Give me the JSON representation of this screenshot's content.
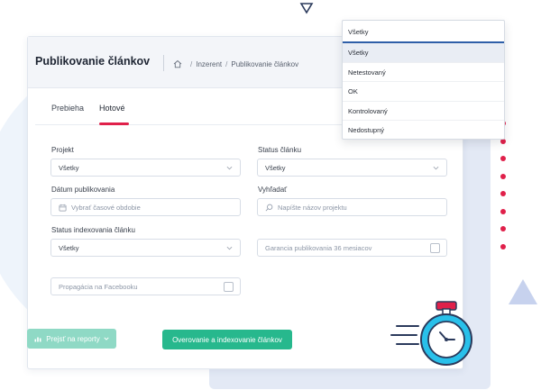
{
  "header": {
    "title": "Publikovanie článkov",
    "breadcrumb": {
      "home_icon": "home-icon",
      "items": [
        "Inzerent",
        "Publikovanie článkov"
      ]
    }
  },
  "tabs": [
    {
      "label": "Prebieha",
      "active": false
    },
    {
      "label": "Hotové",
      "active": true
    }
  ],
  "filters": {
    "projekt": {
      "label": "Projekt",
      "value": "Všetky"
    },
    "status_clanku": {
      "label": "Status článku",
      "value": "Všetky"
    },
    "datum": {
      "label": "Dátum publikovania",
      "placeholder": "Vybrať časové obdobie"
    },
    "vyhladat": {
      "label": "Vyhľadať",
      "placeholder": "Napíšte názov projektu"
    },
    "status_indexovania": {
      "label": "Status indexovania článku",
      "value": "Všetky"
    },
    "garancia": {
      "label": "Garancia publikovania 36 mesiacov",
      "checked": false
    },
    "propagacia": {
      "label": "Propagácia na Facebooku",
      "checked": false
    }
  },
  "buttons": {
    "report": "Prejsť na reporty",
    "verify": "Overovanie a indexovanie článkov"
  },
  "dropdown": {
    "current": "Všetky",
    "options": [
      "Všetky",
      "Netestovaný",
      "OK",
      "Kontrolovaný",
      "Nedostupný"
    ],
    "selected": "Všetky"
  },
  "colors": {
    "accent": "#e0204a",
    "primary_green": "#27b88d",
    "light_green": "#8fd9c5",
    "dropdown_focus": "#2e5fa8"
  }
}
